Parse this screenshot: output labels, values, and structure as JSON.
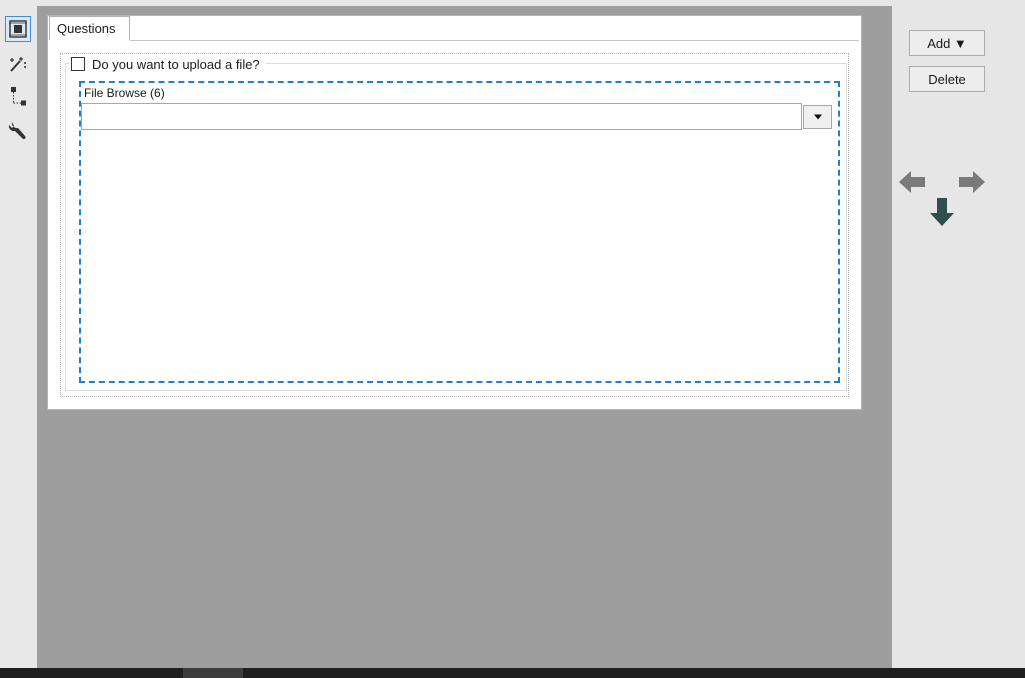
{
  "toolstrip": {
    "tools": [
      {
        "icon": "layout-frame-icon",
        "active": true
      },
      {
        "icon": "magic-wand-icon",
        "active": false
      },
      {
        "icon": "tree-structure-icon",
        "active": false
      },
      {
        "icon": "wrench-icon",
        "active": false
      }
    ]
  },
  "form": {
    "tab_label": "Questions",
    "group": {
      "checkbox_label": "Do you want to upload a file?",
      "checked": false
    },
    "file_browse": {
      "label": "File Browse (6)",
      "value": "",
      "dropdown_icon": "caret-down-icon"
    }
  },
  "rightpanel": {
    "add_label": "Add ▼",
    "delete_label": "Delete",
    "move_arrows": [
      "arrow-up-icon",
      "arrow-left-icon",
      "arrow-right-icon",
      "arrow-down-icon"
    ]
  },
  "colors": {
    "canvas": "#9e9e9e",
    "dropzone_border": "#1f7fd0",
    "arrow_active": "#2f4f4f",
    "arrow_inactive": "#7a7a7a"
  }
}
